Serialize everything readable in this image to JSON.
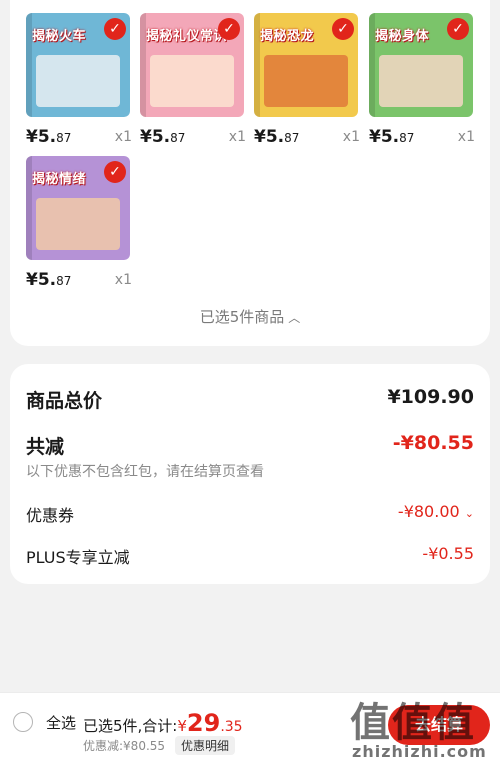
{
  "products": [
    {
      "title": "揭秘火车",
      "bg": "#6fb7d6",
      "art": "#e8eef2",
      "price_int": "¥5.",
      "price_dec": "87",
      "qty": "x1"
    },
    {
      "title": "揭秘礼仪常识",
      "bg": "#f3a7b8",
      "art": "#fbe3d0",
      "price_int": "¥5.",
      "price_dec": "87",
      "qty": "x1"
    },
    {
      "title": "揭秘恐龙",
      "bg": "#f2c94c",
      "art": "#e07a3a",
      "price_int": "¥5.",
      "price_dec": "87",
      "qty": "x1"
    },
    {
      "title": "揭秘身体",
      "bg": "#7bc46a",
      "art": "#f5d7c4",
      "price_int": "¥5.",
      "price_dec": "87",
      "qty": "x1"
    },
    {
      "title": "揭秘情绪",
      "bg": "#b592d6",
      "art": "#f1c9a8",
      "price_int": "¥5.",
      "price_dec": "87",
      "qty": "x1"
    }
  ],
  "selected_summary": "已选5件商品",
  "totals": {
    "goods_total_label": "商品总价",
    "goods_total_value": "¥109.90",
    "reduction_label": "共减",
    "reduction_value": "-¥80.55",
    "reduction_note": "以下优惠不包含红包，请在结算页查看",
    "coupon_label": "优惠券",
    "coupon_value": "-¥80.00",
    "plus_label": "PLUS专享立减",
    "plus_value": "-¥0.55"
  },
  "bottom_bar": {
    "select_all": "全选",
    "selected_count": "已选5件,合计:",
    "currency": "¥",
    "total_int": "29",
    "total_dec": ".35",
    "discount_text": "优惠减:¥80.55",
    "discount_detail": "优惠明细",
    "checkout": "去结算"
  },
  "watermark": {
    "big": "值值值",
    "small": "zhizhizhi.com"
  },
  "colors": {
    "accent": "#e1251b",
    "background": "#f2f2f2"
  }
}
